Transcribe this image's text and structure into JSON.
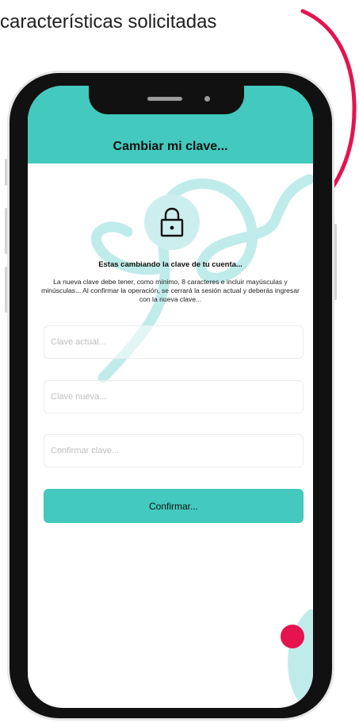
{
  "caption": "características solicitadas",
  "screen": {
    "title": "Cambiar mi clave...",
    "heading": "Estas cambiando la clave de tu cuenta...",
    "description": "La nueva clave debe tener, como mínimo, 8 caracteres e incluir mayúsculas y minúsculas... Al confirmar la operación, se cerrará la sesión actual y deberás ingresar con la nueva clave...",
    "fields": {
      "current": {
        "placeholder": "Clave actual...",
        "value": ""
      },
      "new": {
        "placeholder": "Clave nueva...",
        "value": ""
      },
      "confirm": {
        "placeholder": "Confirmar clave...",
        "value": ""
      }
    },
    "confirm_button": "Confirmar..."
  },
  "icons": {
    "lock": "lock-icon",
    "arrow": "curved-arrow-icon"
  },
  "colors": {
    "accent": "#43c9be",
    "arrow": "#e5134f",
    "decoration": "#bfecea",
    "lock_bg": "#cdeeee",
    "dot": "#e5134f"
  }
}
